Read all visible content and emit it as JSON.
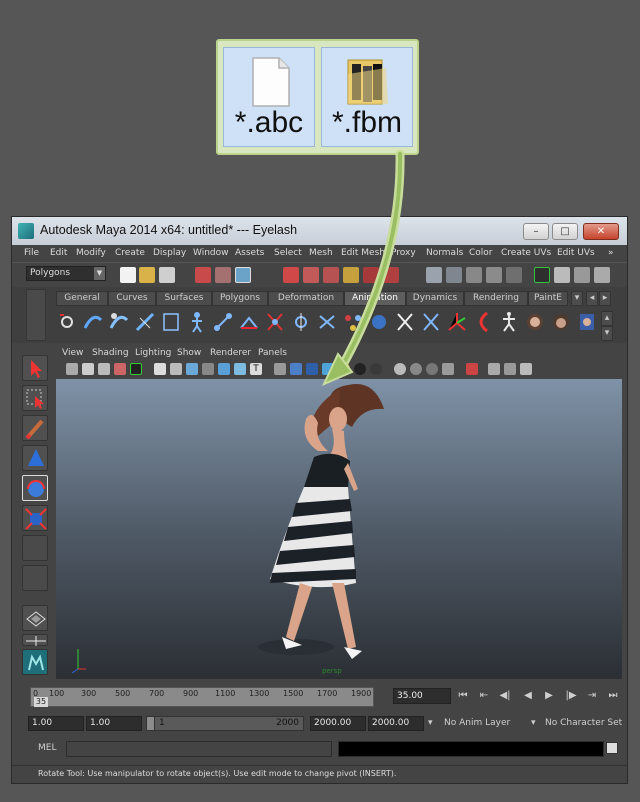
{
  "overlay": {
    "files": [
      {
        "label": "*.abc",
        "icon": "document-icon"
      },
      {
        "label": "*.fbm",
        "icon": "folder-icon"
      }
    ],
    "accent": "#b9d48a"
  },
  "window": {
    "title": "Autodesk Maya 2014 x64: untitled*   ---   Eyelash",
    "controls": {
      "minimize": "–",
      "maximize": "□",
      "close": "✕"
    }
  },
  "menu": [
    "File",
    "Edit",
    "Modify",
    "Create",
    "Display",
    "Window",
    "Assets",
    "Select",
    "Mesh",
    "Edit Mesh",
    "Proxy",
    "Normals",
    "Color",
    "Create UVs",
    "Edit UVs"
  ],
  "menu_more": "»",
  "status": {
    "mode": "Polygons"
  },
  "shelf": {
    "tabs": [
      "General",
      "Curves",
      "Surfaces",
      "Polygons",
      "Deformation",
      "Animation",
      "Dynamics",
      "Rendering",
      "PaintE"
    ],
    "active_tab": "Animation"
  },
  "panel_menu": [
    "View",
    "Shading",
    "Lighting",
    "Show",
    "Renderer",
    "Panels"
  ],
  "viewport": {
    "camera_label": "persp"
  },
  "timeline": {
    "ticks": [
      "0",
      "100",
      "300",
      "500",
      "700",
      "900",
      "1100",
      "1300",
      "1500",
      "1700",
      "1900"
    ],
    "current_frame": "35",
    "frame_field": "35.00",
    "controls": {
      "go_start": "⏮",
      "step_back_key": "⇤",
      "step_back": "◀|",
      "play_back": "◀",
      "play_fwd": "▶",
      "step_fwd": "|▶",
      "step_fwd_key": "⇥",
      "go_end": "⏭"
    }
  },
  "range": {
    "start": "1.00",
    "playback_start": "1.00",
    "slider_left": "1",
    "slider_right": "2000",
    "playback_end": "2000.00",
    "end": "2000.00",
    "anim_layer": "No Anim Layer",
    "char_set": "No Character Set"
  },
  "mel": {
    "label": "MEL"
  },
  "help": {
    "text": "Rotate Tool: Use manipulator to rotate object(s). Use edit mode to change pivot (INSERT)."
  }
}
